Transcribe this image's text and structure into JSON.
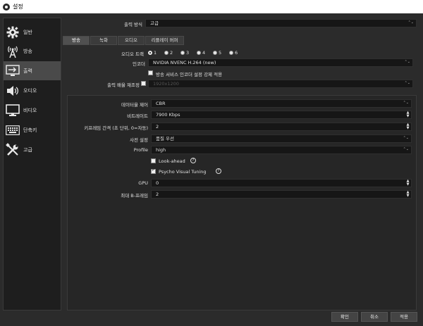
{
  "window": {
    "title": "설정"
  },
  "sidebar": {
    "items": [
      {
        "label": "일반",
        "icon": "gear-icon"
      },
      {
        "label": "방송",
        "icon": "broadcast-antenna-icon"
      },
      {
        "label": "출력",
        "icon": "output-monitor-icon"
      },
      {
        "label": "오디오",
        "icon": "speaker-icon"
      },
      {
        "label": "비디오",
        "icon": "monitor-icon"
      },
      {
        "label": "단축키",
        "icon": "keyboard-icon"
      },
      {
        "label": "고급",
        "icon": "tools-icon"
      }
    ],
    "active_index": 2
  },
  "output_mode": {
    "label": "출력 방식",
    "value": "고급"
  },
  "tabs": [
    "방송",
    "녹화",
    "오디오",
    "리플레이 버퍼"
  ],
  "audio_track": {
    "label": "오디오 트랙",
    "options": [
      "1",
      "2",
      "3",
      "4",
      "5",
      "6"
    ],
    "selected": "1"
  },
  "encoder": {
    "label": "인코더",
    "value": "NVIDIA NVENC H.264 (new)"
  },
  "enforce_service": {
    "label": "방송 서비스 인코더 설정 강제 적용"
  },
  "rescale": {
    "label": "출력 배율 재조정",
    "value": "1920x1200"
  },
  "settings": {
    "rate_control": {
      "label": "데이터율 제어",
      "value": "CBR"
    },
    "bitrate": {
      "label": "비트레이트",
      "value": "7900 Kbps"
    },
    "keyframe": {
      "label": "키프레임 간격 (초 단위, 0=자동)",
      "value": "2"
    },
    "preset": {
      "label": "사전 설정",
      "value": "품질 우선"
    },
    "profile": {
      "label": "Profile",
      "value": "high"
    },
    "lookahead": {
      "label": "Look-ahead",
      "checked": false
    },
    "psycho": {
      "label": "Psycho Visual Tuning",
      "checked": true
    },
    "gpu": {
      "label": "GPU",
      "value": "0"
    },
    "bframes": {
      "label": "최대 B-프레임",
      "value": "2"
    }
  },
  "buttons": {
    "ok": "확인",
    "cancel": "취소",
    "apply": "적용"
  },
  "colors": {
    "background": "#2b2b2b",
    "field": "#161616",
    "sidebar_active": "#4a4a4a"
  }
}
